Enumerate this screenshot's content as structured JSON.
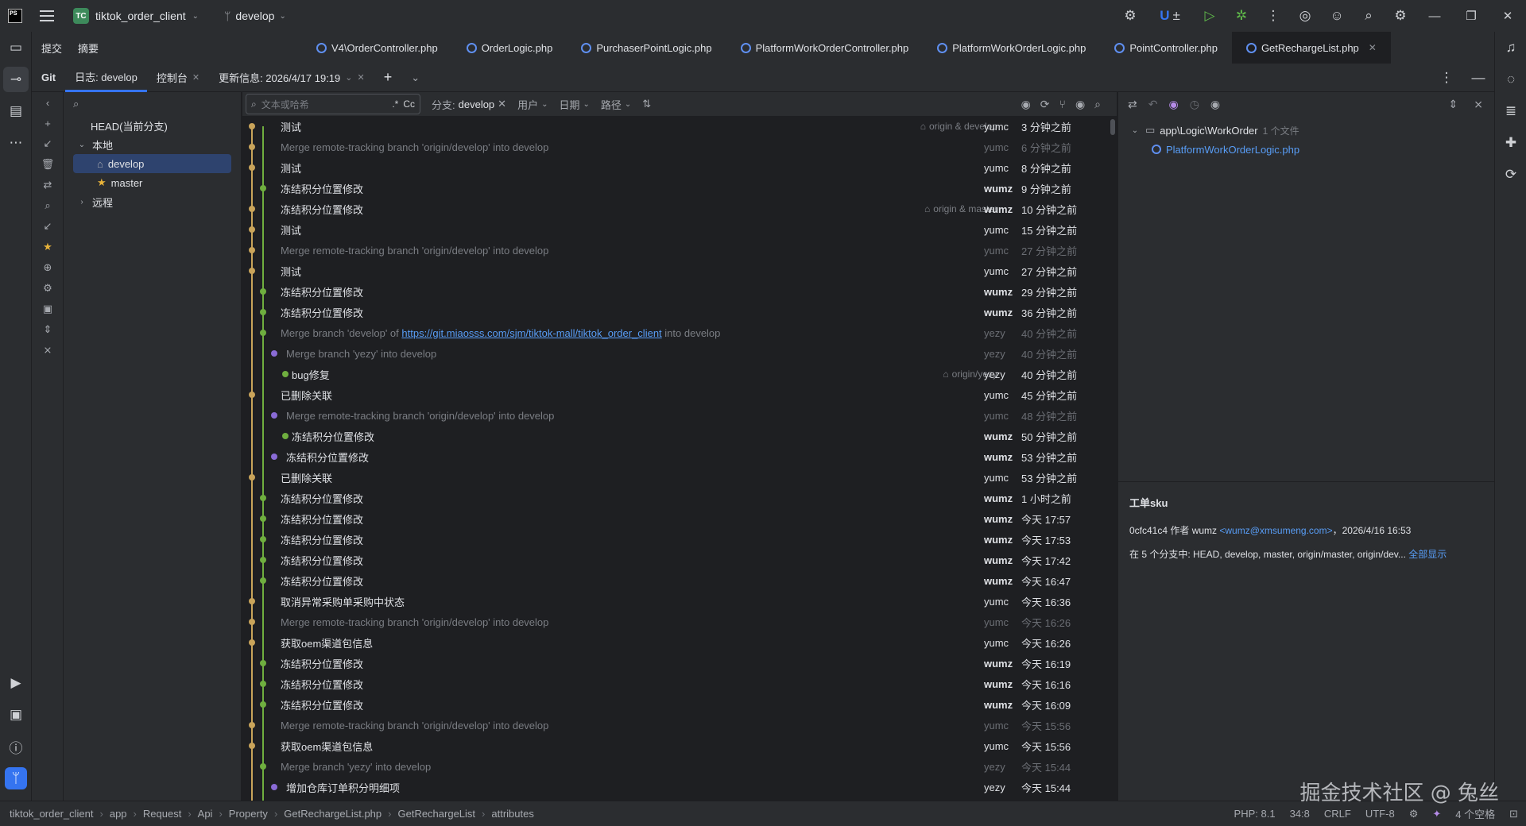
{
  "titlebar": {
    "project_badge": "TC",
    "project_name": "tiktok_order_client",
    "branch": "develop",
    "undo_label": "±"
  },
  "left_toolbar": [
    "folder-icon",
    "commit-icon",
    "structure-icon",
    "more-icon"
  ],
  "tool_tabs": [
    "提交",
    "摘要"
  ],
  "editor_tabs": [
    {
      "label": "V4\\OrderController.php"
    },
    {
      "label": "OrderLogic.php"
    },
    {
      "label": "PurchaserPointLogic.php"
    },
    {
      "label": "PlatformWorkOrderController.php"
    },
    {
      "label": "PlatformWorkOrderLogic.php"
    },
    {
      "label": "PointController.php"
    },
    {
      "label": "GetRechargeList.php"
    }
  ],
  "git_tabs": {
    "git": "Git",
    "log": "日志: develop",
    "console": "控制台",
    "update": "更新信息: 2026/4/17 19:19"
  },
  "branch_tree": {
    "head": "HEAD(当前分支)",
    "local": "本地",
    "develop": "develop",
    "master": "master",
    "remote": "远程"
  },
  "filter": {
    "placeholder": "文本或哈希",
    "regex": ".*",
    "case": "Cc",
    "branch_label": "分支:",
    "branch_value": "develop",
    "user": "用户",
    "date": "日期",
    "path": "路径"
  },
  "commits": [
    {
      "msg": "测试",
      "refs": "origin & develop",
      "author": "yumc",
      "date": "3 分钟之前",
      "merge": false,
      "bold": false
    },
    {
      "msg": "Merge remote-tracking branch 'origin/develop' into develop",
      "refs": "",
      "author": "yumc",
      "date": "6 分钟之前",
      "merge": true,
      "bold": false
    },
    {
      "msg": "测试",
      "refs": "",
      "author": "yumc",
      "date": "8 分钟之前",
      "merge": false,
      "bold": false
    },
    {
      "msg": "冻结积分位置修改",
      "refs": "",
      "author": "wumz",
      "date": "9 分钟之前",
      "merge": false,
      "bold": true
    },
    {
      "msg": "冻结积分位置修改",
      "refs": "origin & master",
      "author": "wumz",
      "date": "10 分钟之前",
      "merge": false,
      "bold": true
    },
    {
      "msg": "测试",
      "refs": "",
      "author": "yumc",
      "date": "15 分钟之前",
      "merge": false,
      "bold": false
    },
    {
      "msg": "Merge remote-tracking branch 'origin/develop' into develop",
      "refs": "",
      "author": "yumc",
      "date": "27 分钟之前",
      "merge": true,
      "bold": false
    },
    {
      "msg": "测试",
      "refs": "",
      "author": "yumc",
      "date": "27 分钟之前",
      "merge": false,
      "bold": false
    },
    {
      "msg": "冻结积分位置修改",
      "refs": "",
      "author": "wumz",
      "date": "29 分钟之前",
      "merge": false,
      "bold": true
    },
    {
      "msg": "冻结积分位置修改",
      "refs": "",
      "author": "wumz",
      "date": "36 分钟之前",
      "merge": false,
      "bold": true
    },
    {
      "msg_pre": "Merge branch 'develop' of ",
      "msg_link": "https://git.miaosss.com/sjm/tiktok-mall/tiktok_order_client",
      "msg_post": " into develop",
      "refs": "",
      "author": "yezy",
      "date": "40 分钟之前",
      "merge": true,
      "bold": false
    },
    {
      "msg": "Merge branch 'yezy' into develop",
      "refs": "",
      "author": "yezy",
      "date": "40 分钟之前",
      "merge": true,
      "bold": false
    },
    {
      "msg": "bug修复",
      "refs": "origin/yezy",
      "author": "yezy",
      "date": "40 分钟之前",
      "merge": false,
      "bold": false
    },
    {
      "msg": "已删除关联",
      "refs": "",
      "author": "yumc",
      "date": "45 分钟之前",
      "merge": false,
      "bold": false
    },
    {
      "msg": "Merge remote-tracking branch 'origin/develop' into develop",
      "refs": "",
      "author": "yumc",
      "date": "48 分钟之前",
      "merge": true,
      "bold": false
    },
    {
      "msg": "冻结积分位置修改",
      "refs": "",
      "author": "wumz",
      "date": "50 分钟之前",
      "merge": false,
      "bold": true
    },
    {
      "msg": "冻结积分位置修改",
      "refs": "",
      "author": "wumz",
      "date": "53 分钟之前",
      "merge": false,
      "bold": true
    },
    {
      "msg": "已删除关联",
      "refs": "",
      "author": "yumc",
      "date": "53 分钟之前",
      "merge": false,
      "bold": false
    },
    {
      "msg": "冻结积分位置修改",
      "refs": "",
      "author": "wumz",
      "date": "1 小时之前",
      "merge": false,
      "bold": true
    },
    {
      "msg": "冻结积分位置修改",
      "refs": "",
      "author": "wumz",
      "date": "今天 17:57",
      "merge": false,
      "bold": true
    },
    {
      "msg": "冻结积分位置修改",
      "refs": "",
      "author": "wumz",
      "date": "今天 17:53",
      "merge": false,
      "bold": true
    },
    {
      "msg": "冻结积分位置修改",
      "refs": "",
      "author": "wumz",
      "date": "今天 17:42",
      "merge": false,
      "bold": true
    },
    {
      "msg": "冻结积分位置修改",
      "refs": "",
      "author": "wumz",
      "date": "今天 16:47",
      "merge": false,
      "bold": true
    },
    {
      "msg": "取消异常采购单采购中状态",
      "refs": "",
      "author": "yumc",
      "date": "今天 16:36",
      "merge": false,
      "bold": false
    },
    {
      "msg": "Merge remote-tracking branch 'origin/develop' into develop",
      "refs": "",
      "author": "yumc",
      "date": "今天 16:26",
      "merge": true,
      "bold": false
    },
    {
      "msg": "获取oem渠道包信息",
      "refs": "",
      "author": "yumc",
      "date": "今天 16:26",
      "merge": false,
      "bold": false
    },
    {
      "msg": "冻结积分位置修改",
      "refs": "",
      "author": "wumz",
      "date": "今天 16:19",
      "merge": false,
      "bold": true
    },
    {
      "msg": "冻结积分位置修改",
      "refs": "",
      "author": "wumz",
      "date": "今天 16:16",
      "merge": false,
      "bold": true
    },
    {
      "msg": "冻结积分位置修改",
      "refs": "",
      "author": "wumz",
      "date": "今天 16:09",
      "merge": false,
      "bold": true
    },
    {
      "msg": "Merge remote-tracking branch 'origin/develop' into develop",
      "refs": "",
      "author": "yumc",
      "date": "今天 15:56",
      "merge": true,
      "bold": false
    },
    {
      "msg": "获取oem渠道包信息",
      "refs": "",
      "author": "yumc",
      "date": "今天 15:56",
      "merge": false,
      "bold": false
    },
    {
      "msg": "Merge branch 'yezy' into develop",
      "refs": "",
      "author": "yezy",
      "date": "今天 15:44",
      "merge": true,
      "bold": false
    },
    {
      "msg": "增加仓库订单积分明细项",
      "refs": "",
      "author": "yezy",
      "date": "今天 15:44",
      "merge": false,
      "bold": false
    }
  ],
  "graph_lanes": [
    0,
    0,
    0,
    1,
    0,
    0,
    0,
    0,
    1,
    1,
    1,
    2,
    3,
    0,
    2,
    3,
    2,
    0,
    1,
    1,
    1,
    1,
    1,
    0,
    0,
    0,
    1,
    1,
    1,
    0,
    0,
    1,
    2
  ],
  "detail": {
    "folder": "app\\Logic\\WorkOrder",
    "folder_count": "1 个文件",
    "file": "PlatformWorkOrderLogic.php",
    "commit_title": "工单sku",
    "commit_meta_pre": "0cfc41c4 作者 wumz ",
    "commit_email": "<wumz@xmsumeng.com>",
    "commit_meta_post": "，2026/4/16 16:53",
    "branches_text": "在 5 个分支中: HEAD, develop, master, origin/master, origin/dev...",
    "show_all": "全部显示"
  },
  "statusbar": {
    "crumbs": [
      "tiktok_order_client",
      "app",
      "Request",
      "Api",
      "Property",
      "GetRechargeList.php",
      "GetRechargeList",
      "attributes"
    ],
    "php": "PHP: 8.1",
    "pos": "34:8",
    "eol": "CRLF",
    "enc": "UTF-8",
    "indent": "4 个空格"
  },
  "watermark": "掘金技术社区 @ 兔丝",
  "colors": {
    "accent": "#3574f0",
    "lane0": "#c9a45a",
    "lane1": "#6fae3f",
    "lane2": "#8a6bd6",
    "link": "#589df6"
  }
}
